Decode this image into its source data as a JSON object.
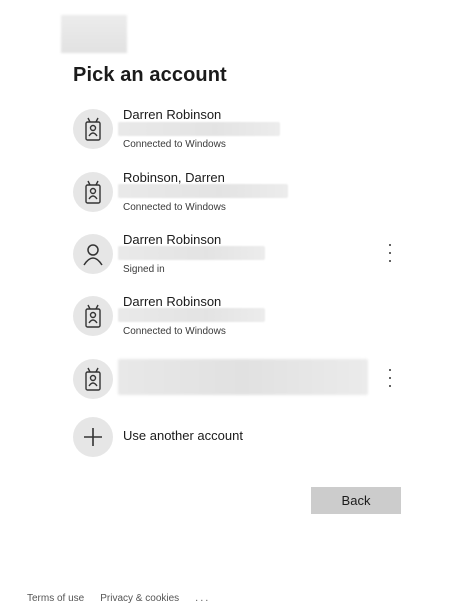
{
  "page": {
    "title": "Pick an account"
  },
  "accounts": [
    {
      "name": "Darren Robinson",
      "status": "Connected to Windows",
      "icon": "badge-icon",
      "has_more_menu": false
    },
    {
      "name": "Robinson, Darren",
      "status": "Connected to Windows",
      "icon": "badge-icon",
      "has_more_menu": false
    },
    {
      "name": "Darren Robinson",
      "status": "Signed in",
      "icon": "person-icon",
      "has_more_menu": true
    },
    {
      "name": "Darren Robinson",
      "status": "Connected to Windows",
      "icon": "badge-icon",
      "has_more_menu": false
    },
    {
      "name": "",
      "status": "",
      "icon": "badge-icon",
      "has_more_menu": true
    }
  ],
  "add_account": {
    "label": "Use another account",
    "icon": "plus-icon"
  },
  "buttons": {
    "back_label": "Back"
  },
  "footer": {
    "terms_label": "Terms of use",
    "privacy_label": "Privacy & cookies",
    "more_label": "..."
  },
  "colors": {
    "avatar_bg": "#e6e6e6",
    "back_button_bg": "#cccccc",
    "text": "#1b1b1b"
  }
}
